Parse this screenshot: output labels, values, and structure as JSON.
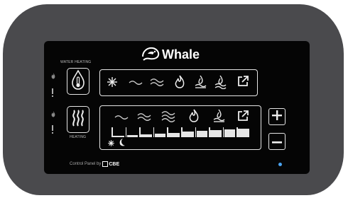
{
  "brand": {
    "name": "Whale"
  },
  "water_heating": {
    "section_label": "WATER HEATING",
    "mode_icons": [
      "snowflake-icon",
      "ripple-low-icon",
      "ripple-mid-icon",
      "flame-icon",
      "flame-low-icon",
      "flame-high-icon",
      "external-link-icon"
    ]
  },
  "heating": {
    "section_label": "HEATING",
    "mode_icons": [
      "ripple-low-icon",
      "ripple-mid-icon",
      "ripple-high-icon",
      "flame-icon",
      "flame-water-icon",
      "external-link-icon"
    ],
    "level_scale": {
      "steps": 10,
      "min_icons": [
        "snowflake-icon",
        "moon-icon"
      ]
    }
  },
  "controls": {
    "plus": "+",
    "minus": "−"
  },
  "footer": {
    "prefix": "Control Panel by",
    "maker": "CBE"
  },
  "colors": {
    "panel": "#4a4a4d",
    "screen": "#050505",
    "led": "#4aa3f0",
    "glyph": "#e6e6e6"
  }
}
